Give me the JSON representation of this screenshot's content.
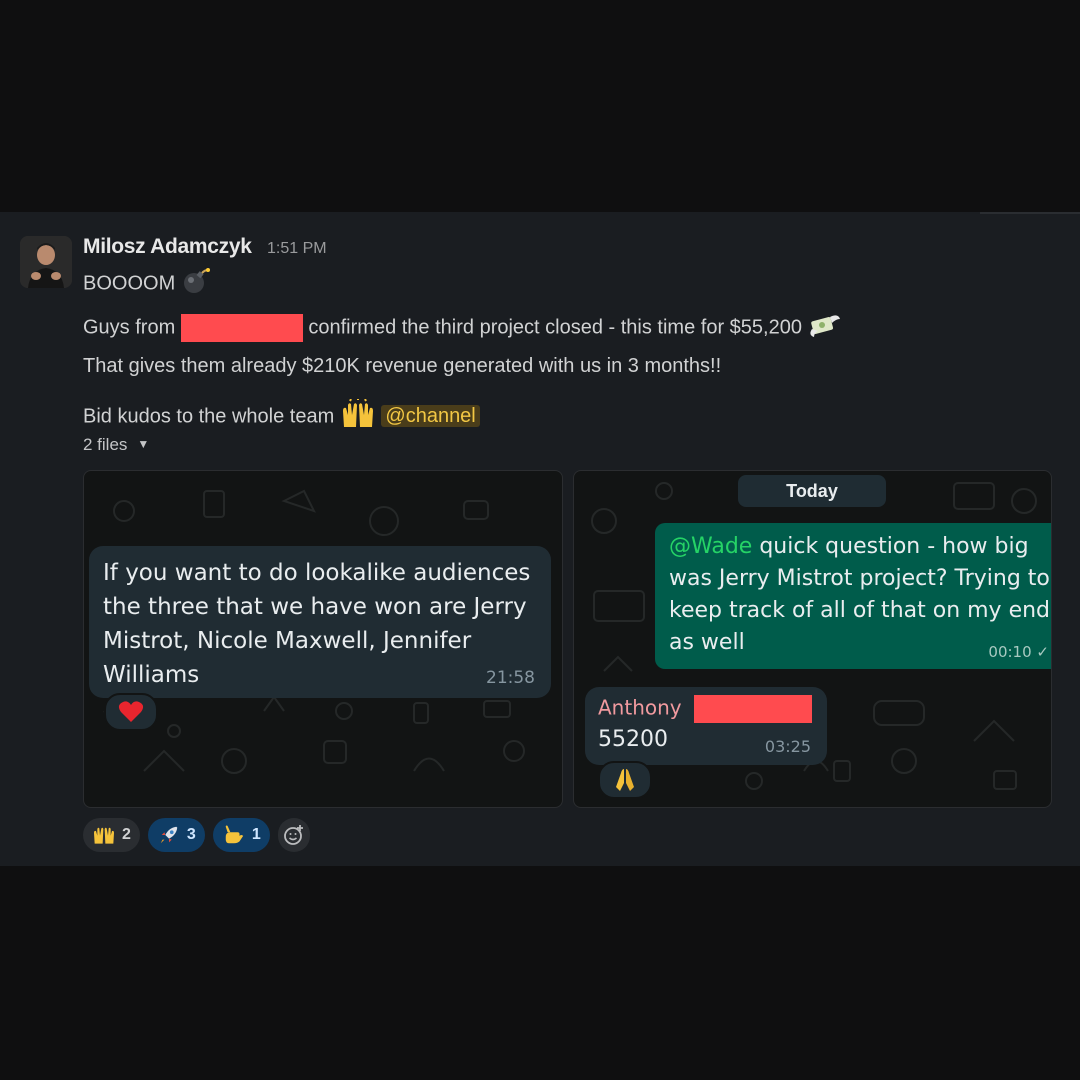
{
  "message": {
    "sender": "Milosz Adamczyk",
    "time": "1:51 PM",
    "line1": "BOOOOM",
    "line2_prefix": "Guys from",
    "line2_suffix": "confirmed the third project closed - this time for $55,200",
    "line3": "That gives them already $210K revenue generated with us in 3 months!!",
    "line4_prefix": "Bid kudos to the whole team",
    "channel_mention": "@channel",
    "files_label": "2 files"
  },
  "attachment1": {
    "text": "If you want to do lookalike audiences the three that we have won are Jerry Mistrot, Nicole Maxwell, Jennifer Williams",
    "time": "21:58"
  },
  "attachment2": {
    "date_chip": "Today",
    "mention": "@Wade",
    "line1_rest": " quick question - how big",
    "line2": "was Jerry Mistrot project? Trying to",
    "line3": "keep track of all of that on my end",
    "line4": "as well",
    "time": "00:10",
    "reply_name": "Anthony",
    "reply_value": "55200",
    "reply_time": "03:25"
  },
  "reactions": [
    {
      "icon": "raised-hands",
      "count": "2"
    },
    {
      "icon": "rocket",
      "count": "3"
    },
    {
      "icon": "call-me-hand",
      "count": "1"
    }
  ],
  "colors": {
    "panel": "#1a1d21",
    "redaction": "#ff4b4f",
    "mention_text": "#f2c744",
    "wa_green_bubble": "#005c4b",
    "wa_dark_bubble": "#202c33",
    "active_reaction": "#0f3d66"
  }
}
